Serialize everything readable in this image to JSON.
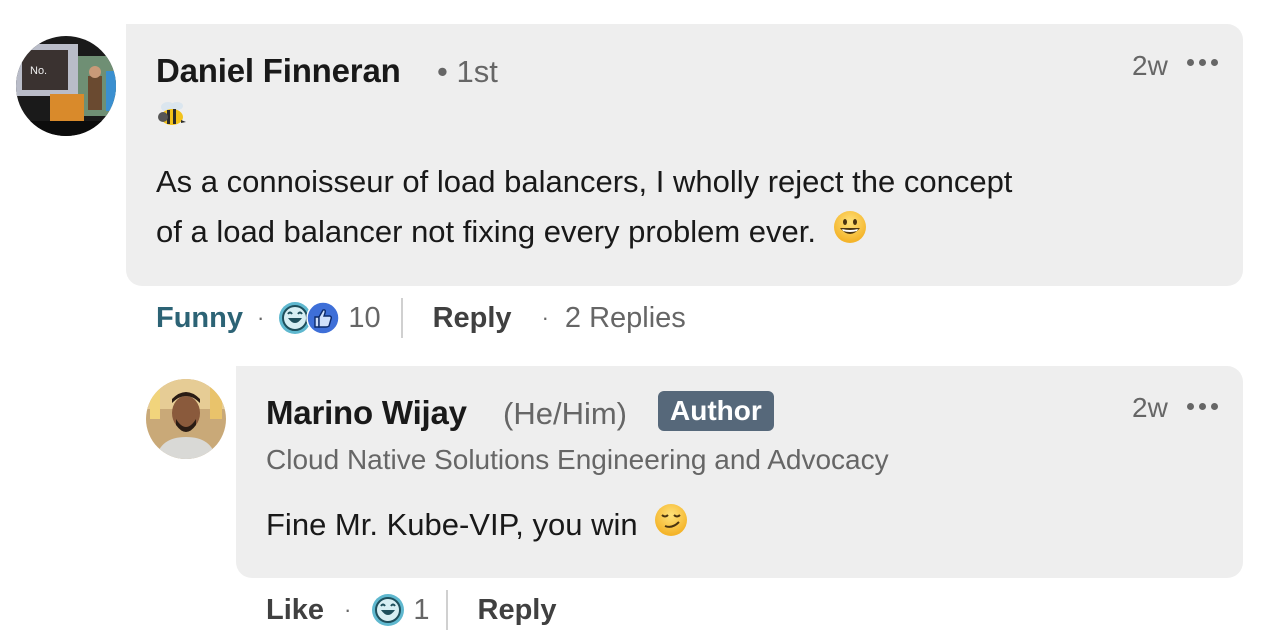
{
  "comments": [
    {
      "author": "Daniel Finneran",
      "degree": "• 1st",
      "headline_emoji": "bee-emoji",
      "time": "2w",
      "text_line1": "As a connoisseur of load balancers, I wholly reject the concept",
      "text_line2": "of a load balancer not fixing every problem ever.",
      "text_emoji": "grinning-face-emoji",
      "actions": {
        "reaction_label": "Funny",
        "reaction_count": "10",
        "reply_label": "Reply",
        "replies_label": "2 Replies"
      }
    }
  ],
  "reply": {
    "author": "Marino Wijay",
    "pronouns": "(He/Him)",
    "badge": "Author",
    "headline": "Cloud Native Solutions Engineering and Advocacy",
    "time": "2w",
    "text": "Fine Mr. Kube-VIP, you win",
    "text_emoji": "smirking-face-emoji",
    "actions": {
      "like_label": "Like",
      "reaction_count": "1",
      "reply_label": "Reply"
    }
  },
  "separator": "·",
  "colors": {
    "bubble": "#eeeeee",
    "funny_text": "#2c6375",
    "badge_bg": "#56687a",
    "secondary_text": "#666666"
  }
}
